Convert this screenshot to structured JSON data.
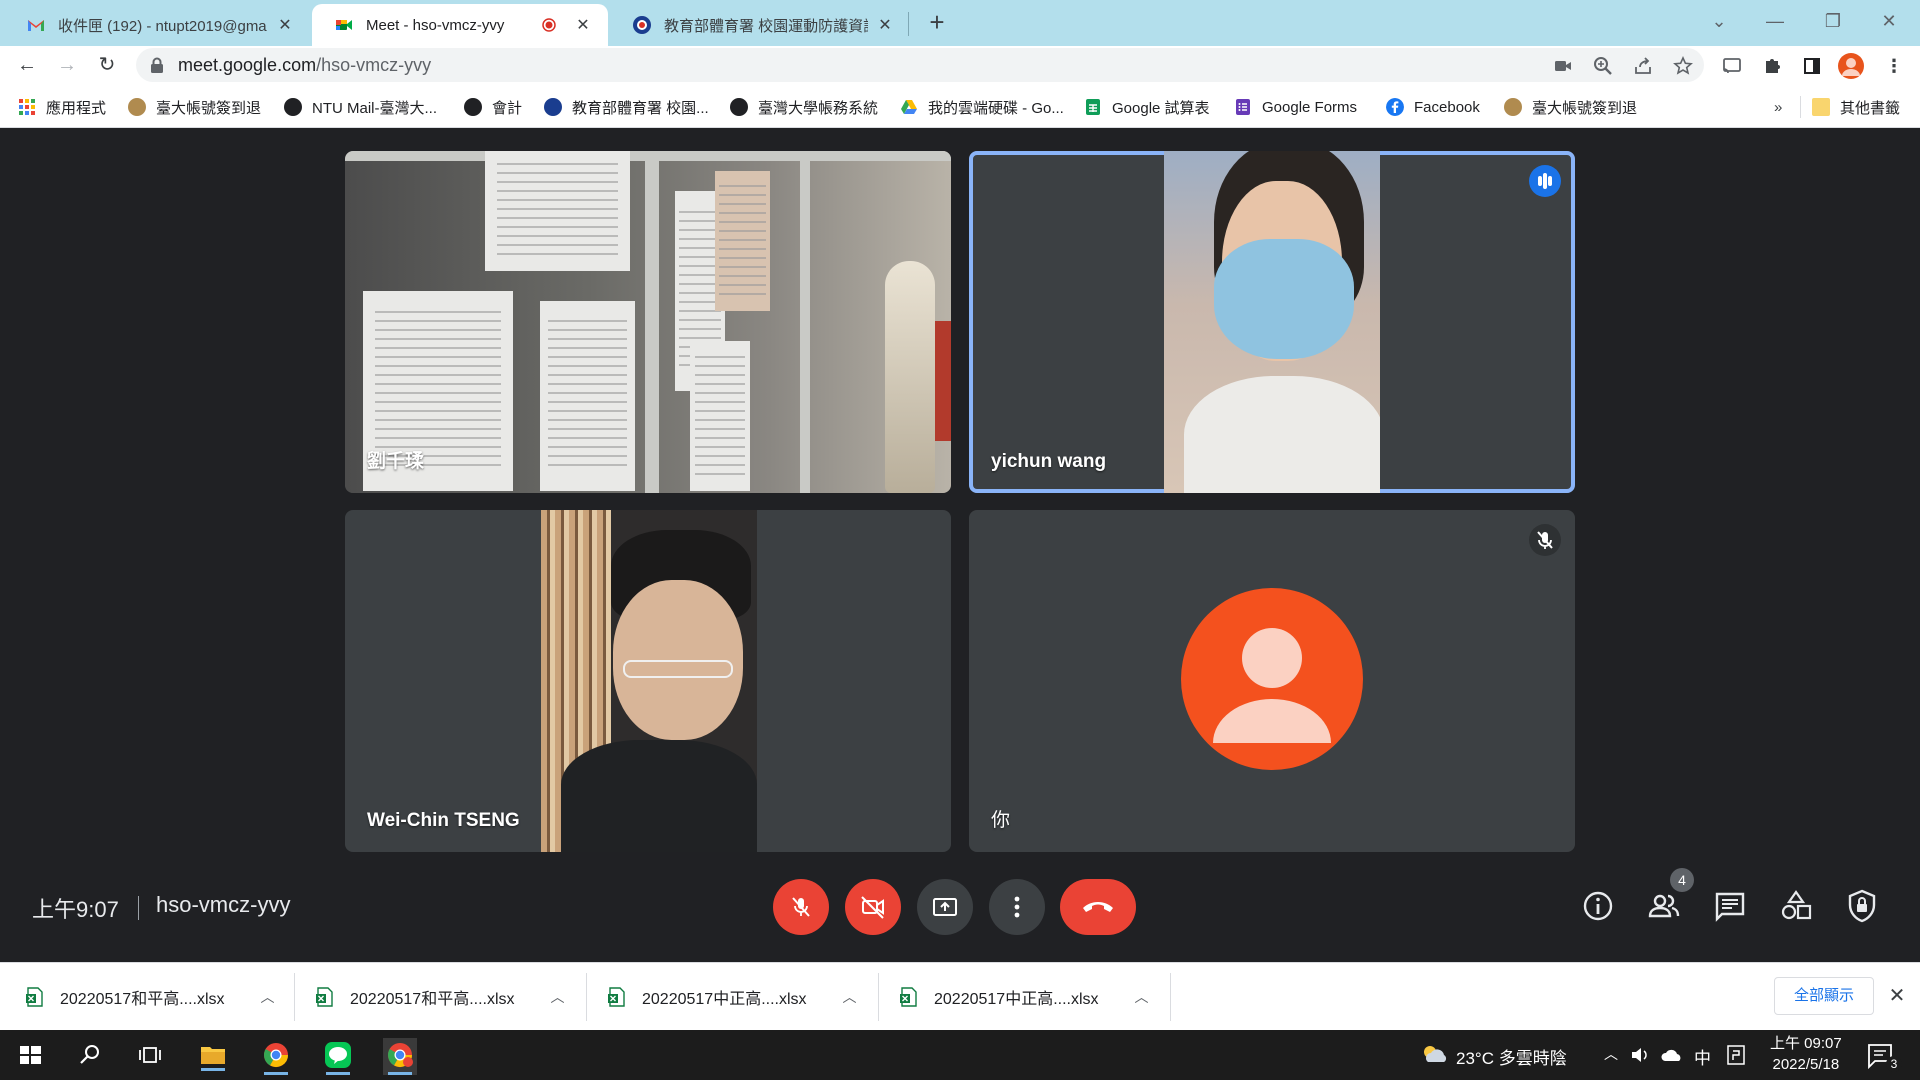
{
  "tabs": [
    {
      "title": "收件匣 (192) - ntupt2019@gma",
      "close": "✕"
    },
    {
      "title": "Meet - hso-vmcz-yvy",
      "close": "✕"
    },
    {
      "title": "教育部體育署 校園運動防護資訊",
      "close": "✕"
    }
  ],
  "new_tab": "+",
  "window_controls": {
    "tab_search": "⌄",
    "minimize": "—",
    "restore": "❐",
    "close": "✕"
  },
  "address": {
    "host": "meet.google.com",
    "path": "/hso-vmcz-yvy"
  },
  "bookmarks": [
    {
      "label": "應用程式",
      "icon": "apps-grid-icon"
    },
    {
      "label": "臺大帳號簽到退",
      "icon": "ntu-seal-icon"
    },
    {
      "label": "NTU Mail-臺灣大...",
      "icon": "globe-icon"
    },
    {
      "label": "會計",
      "icon": "globe-icon"
    },
    {
      "label": "教育部體育署 校園...",
      "icon": "moe-icon"
    },
    {
      "label": "臺灣大學帳務系統",
      "icon": "globe-icon"
    },
    {
      "label": "我的雲端硬碟 - Go...",
      "icon": "drive-icon"
    },
    {
      "label": "Google 試算表",
      "icon": "sheets-icon"
    },
    {
      "label": "Google Forms",
      "icon": "forms-icon"
    },
    {
      "label": "Facebook",
      "icon": "facebook-icon"
    },
    {
      "label": "臺大帳號簽到退",
      "icon": "ntu-seal-icon"
    }
  ],
  "bookmarks_overflow": "»",
  "other_bookmarks": "其他書籤",
  "participants": [
    {
      "name": "劉千瑈"
    },
    {
      "name": "yichun wang"
    },
    {
      "name": "Wei-Chin TSENG"
    },
    {
      "name": "你"
    }
  ],
  "meeting": {
    "time": "上午9:07",
    "code": "hso-vmcz-yvy",
    "participant_count": "4"
  },
  "downloads": [
    {
      "file": "20220517和平高....xlsx"
    },
    {
      "file": "20220517和平高....xlsx"
    },
    {
      "file": "20220517中正高....xlsx"
    },
    {
      "file": "20220517中正高....xlsx"
    }
  ],
  "downloads_show_all": "全部顯示",
  "downloads_close": "✕",
  "taskbar": {
    "weather": "23°C  多雲時陰",
    "ime": "中",
    "clock_time": "上午 09:07",
    "clock_date": "2022/5/18",
    "notifications": "3"
  },
  "colors": {
    "tabstrip": "#b3dfec",
    "meet_bg": "#202124",
    "tile": "#3c4043",
    "red": "#ea4335",
    "speaking": "#8ab4f8",
    "self_avatar": "#f4511e"
  }
}
